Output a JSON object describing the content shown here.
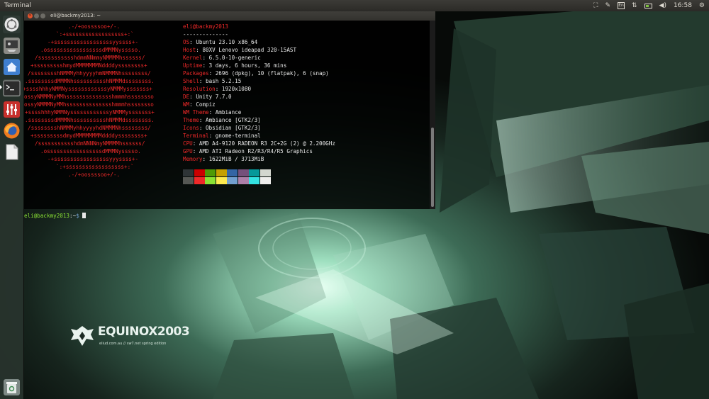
{
  "top_panel": {
    "app_title": "Terminal",
    "clock": "16:58",
    "keyboard_layout": "En"
  },
  "launcher": {
    "items": [
      {
        "name": "dash",
        "icon": "ubuntu-logo-icon"
      },
      {
        "name": "system-settings",
        "icon": "monitor-settings-icon"
      },
      {
        "name": "files",
        "icon": "home-folder-icon"
      },
      {
        "name": "terminal",
        "icon": "terminal-icon"
      },
      {
        "name": "system-monitor",
        "icon": "mixer-icon"
      },
      {
        "name": "firefox",
        "icon": "firefox-icon"
      },
      {
        "name": "text-editor",
        "icon": "text-editor-icon"
      },
      {
        "name": "trash",
        "icon": "trash-icon"
      }
    ]
  },
  "terminal": {
    "title": "eli@backmy2013: ~",
    "close_glyph": "×",
    "logo_lines": [
      ".-/+oossssoo+/-.",
      "`:+ssssssssssssssssss+:`",
      "-+ssssssssssssssssssyyssss+-",
      ".osssssssssssssssssdMMMNysssso.",
      "/ssssssssssshdmmNNmmyNMMMMhssssss/",
      "+ssssssssshmydMMMMMMMNddddyssssssss+",
      "/sssssssshNMMMyhhyyyyhmNMMMNhssssssss/",
      ".ssssssssdMMMNhsssssssssshNMMMdssssssss.",
      "+sssshhhyNMMNyssssssssssssyNMMMysssssss+",
      "ossyNMMMNyMMhsssssssssssssshmmmhssssssso",
      "ossyNMMMNyMMhsssssssssssssshmmmhssssssso",
      "+sssshhhyNMMNyssssssssssssyNMMMysssssss+",
      ".ssssssssdMMMNhsssssssssshNMMMdssssssss.",
      "/sssssssshNMMMyhhyyyyhdNMMMNhssssssss/",
      "+sssssssssdmydMMMMMMMMddddyssssssss+",
      "/ssssssssssshdmNNNNmyNMMMMhssssss/",
      ".osssssssssssssssssdMMMNysssso.",
      "-+sssssssssssssssssyyyssss+-",
      "`:+ssssssssssssssssss+:`",
      ".-/+oossssoo+/-."
    ],
    "user_host": "eli@backmy2013",
    "separator": "--------------",
    "info": [
      {
        "key": "OS",
        "value": "Ubuntu 23.10 x86_64"
      },
      {
        "key": "Host",
        "value": "80XV Lenovo ideapad 320-15AST"
      },
      {
        "key": "Kernel",
        "value": "6.5.0-10-generic"
      },
      {
        "key": "Uptime",
        "value": "3 days, 6 hours, 36 mins"
      },
      {
        "key": "Packages",
        "value": "2696 (dpkg), 10 (flatpak), 6 (snap)"
      },
      {
        "key": "Shell",
        "value": "bash 5.2.15"
      },
      {
        "key": "Resolution",
        "value": "1920x1080"
      },
      {
        "key": "DE",
        "value": "Unity 7.7.0"
      },
      {
        "key": "WM",
        "value": "Compiz"
      },
      {
        "key": "WM Theme",
        "value": "Ambiance"
      },
      {
        "key": "Theme",
        "value": "Ambiance [GTK2/3]"
      },
      {
        "key": "Icons",
        "value": "Obsidian [GTK2/3]"
      },
      {
        "key": "Terminal",
        "value": "gnome-terminal"
      },
      {
        "key": "CPU",
        "value": "AMD A4-9120 RADEON R3 2C+2G (2) @ 2.200GHz"
      },
      {
        "key": "GPU",
        "value": "AMD ATI Radeon R2/R3/R4/R5 Graphics"
      },
      {
        "key": "Memory",
        "value": "1622MiB / 3713MiB"
      }
    ],
    "palette_top": [
      "#2e3436",
      "#cc0000",
      "#4e9a06",
      "#c4a000",
      "#3465a4",
      "#75507b",
      "#06989a",
      "#d3d7cf"
    ],
    "palette_bottom": [
      "#555753",
      "#ef2929",
      "#8ae234",
      "#fce94f",
      "#729fcf",
      "#ad7fa8",
      "#34e2e2",
      "#eeeeec"
    ],
    "prompt_user": "eli@backmy2013",
    "prompt_path": ":~",
    "prompt_symbol": "$"
  },
  "wallpaper": {
    "logo_title": "EQUINOX2003",
    "logo_subtitle": "eliud.com.au // sw7.net spring edition"
  },
  "colors": {
    "ansi_red": "#ef2929",
    "prompt_green": "#8ae234",
    "prompt_blue": "#729fcf",
    "close_button": "#e4532c",
    "wallpaper_glow": "#9fe0c0"
  }
}
